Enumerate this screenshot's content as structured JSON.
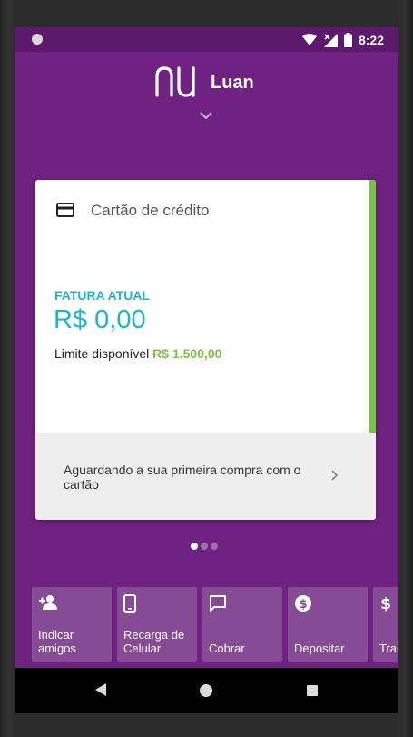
{
  "status_bar": {
    "time": "8:22",
    "icons": [
      "notification-dot-icon",
      "wifi-icon",
      "signal-no-data-icon",
      "battery-icon"
    ]
  },
  "header": {
    "logo": "nu-logo",
    "account_name": "Luan",
    "expand_icon": "chevron-down-icon"
  },
  "card": {
    "icon": "credit-card-icon",
    "title": "Cartão de crédito",
    "fatura_label": "FATURA ATUAL",
    "fatura_value": "R$ 0,00",
    "limit_label": "Limite disponível",
    "limit_value": "R$ 1.500,00",
    "footer_text": "Aguardando a sua primeira compra com o cartão",
    "footer_icon": "chevron-right-icon",
    "colors": {
      "accent": "#7ac143",
      "primary": "#1cb5cb"
    }
  },
  "pager": {
    "count": 3,
    "active_index": 0
  },
  "shortcuts": [
    {
      "icon": "person-add-icon",
      "label": "Indicar\namigos"
    },
    {
      "icon": "phone-icon",
      "label": "Recarga de\nCelular"
    },
    {
      "icon": "chat-icon",
      "label": "Cobrar"
    },
    {
      "icon": "dollar-circle-icon",
      "label": "Depositar"
    },
    {
      "icon": "dollar-icon",
      "label": "Transferir"
    }
  ],
  "nav_bar": {
    "icons": [
      "back-icon",
      "home-icon",
      "recents-icon"
    ]
  },
  "theme": {
    "background": "#6f2281",
    "tile": "#864b95"
  }
}
